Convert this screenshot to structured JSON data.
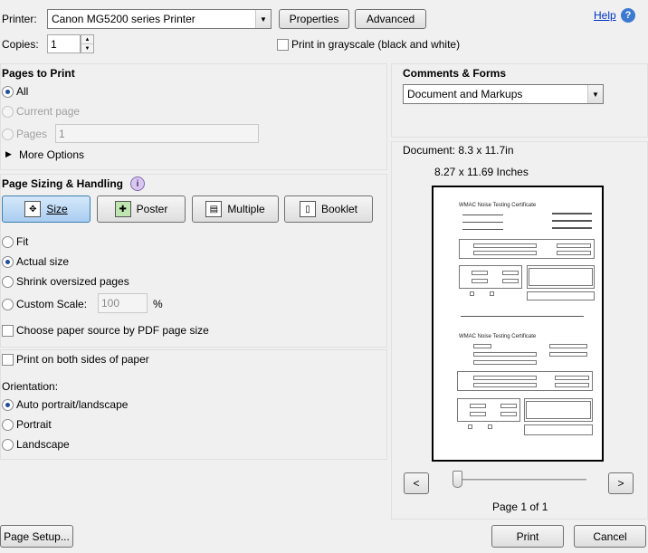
{
  "printer": {
    "label": "Printer:",
    "selected": "Canon MG5200 series Printer",
    "properties_label": "Properties",
    "advanced_label": "Advanced",
    "help_label": "Help"
  },
  "copies": {
    "label": "Copies:",
    "value": "1"
  },
  "grayscale": {
    "label": "Print in grayscale (black and white)",
    "checked": false
  },
  "pages_to_print": {
    "title": "Pages to Print",
    "all_label": "All",
    "current_label": "Current page",
    "pages_label": "Pages",
    "pages_value": "1",
    "more_options_label": "More Options"
  },
  "sizing": {
    "title": "Page Sizing & Handling",
    "tabs": [
      "Size",
      "Poster",
      "Multiple",
      "Booklet"
    ],
    "fit_label": "Fit",
    "actual_label": "Actual size",
    "shrink_label": "Shrink oversized pages",
    "custom_label": "Custom Scale:",
    "custom_value": "100",
    "percent": "%",
    "paper_source_label": "Choose paper source by PDF page size"
  },
  "duplex": {
    "label": "Print on both sides of paper"
  },
  "orientation": {
    "title": "Orientation:",
    "auto_label": "Auto portrait/landscape",
    "portrait_label": "Portrait",
    "landscape_label": "Landscape"
  },
  "comments_forms": {
    "title": "Comments & Forms",
    "selected": "Document and Markups"
  },
  "preview": {
    "document_size": "Document: 8.3 x 11.7in",
    "paper_size": "8.27 x 11.69 Inches",
    "page_indicator": "Page 1 of 1",
    "prev_label": "<",
    "next_label": ">",
    "doc_title_1": "WMAC Noise Testing Certificate",
    "doc_title_2": "WMAC Noise Testing Certificate"
  },
  "footer": {
    "page_setup_label": "Page Setup...",
    "print_label": "Print",
    "cancel_label": "Cancel"
  },
  "colors": {
    "accent": "#1f4f9a",
    "help_link": "#0033cc",
    "selected_tab": "#bcd8f4"
  }
}
